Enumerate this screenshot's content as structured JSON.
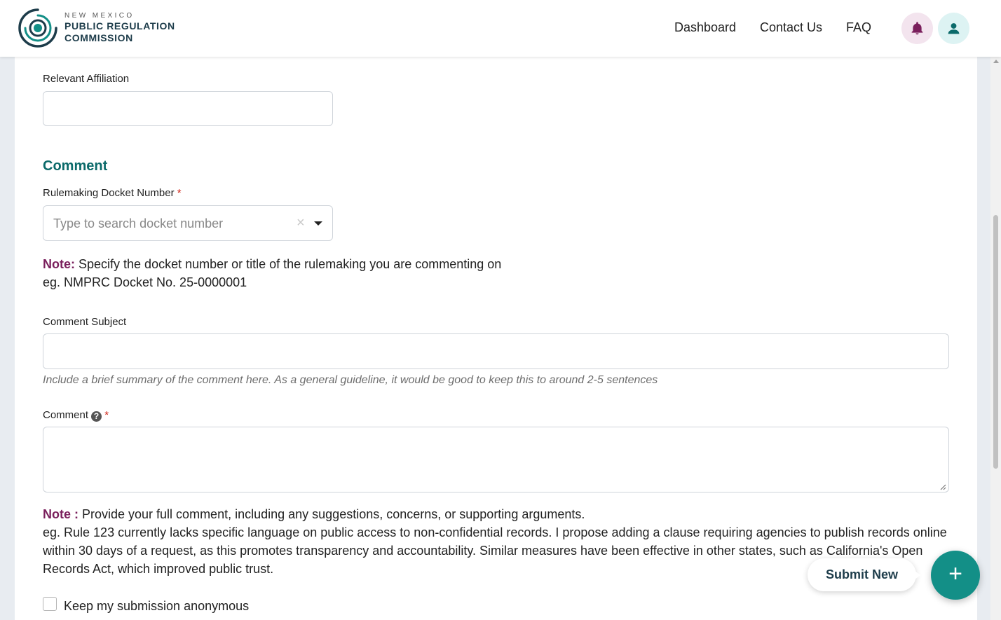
{
  "brand": {
    "line1": "NEW MEXICO",
    "line2": "PUBLIC REGULATION",
    "line3": "COMMISSION",
    "colors": {
      "primary": "#0b6a6a",
      "accent": "#138f87",
      "note": "#7a1f5c",
      "navy": "#1d3c4a"
    }
  },
  "header": {
    "nav": [
      "Dashboard",
      "Contact Us",
      "FAQ"
    ],
    "icons": [
      "bell-icon",
      "user-icon"
    ]
  },
  "form": {
    "affiliation_label": "Relevant Affiliation",
    "affiliation_value": "",
    "section_title": "Comment",
    "docket_label": "Rulemaking Docket Number",
    "required_mark": "*",
    "docket_placeholder": "Type to search docket number",
    "clear_symbol": "×",
    "note1_label": "Note:",
    "note1_text": " Specify the docket number or title of the rulemaking you are commenting on",
    "note1_example": "eg. NMPRC Docket No. 25-0000001",
    "subject_label": "Comment Subject",
    "subject_value": "",
    "subject_helper": "Include a brief summary of the comment here. As a general guideline, it would be good to keep this to around 2-5 sentences",
    "comment_label": "Comment",
    "comment_help_symbol": "?",
    "comment_value": "",
    "note2_label": "Note :",
    "note2_text": " Provide your full comment, including any suggestions, concerns, or supporting arguments.",
    "note2_example": "eg. Rule 123 currently lacks specific language on public access to non-confidential records. I propose adding a clause requiring agencies to publish records online within 30 days of a request, as this promotes transparency and accountability. Similar measures have been effective in other states, such as California's Open Records Act, which improved public trust.",
    "anonymous_label": "Keep my submission anonymous",
    "anonymous_checked": false
  },
  "fab": {
    "label": "Submit New",
    "symbol": "+"
  }
}
